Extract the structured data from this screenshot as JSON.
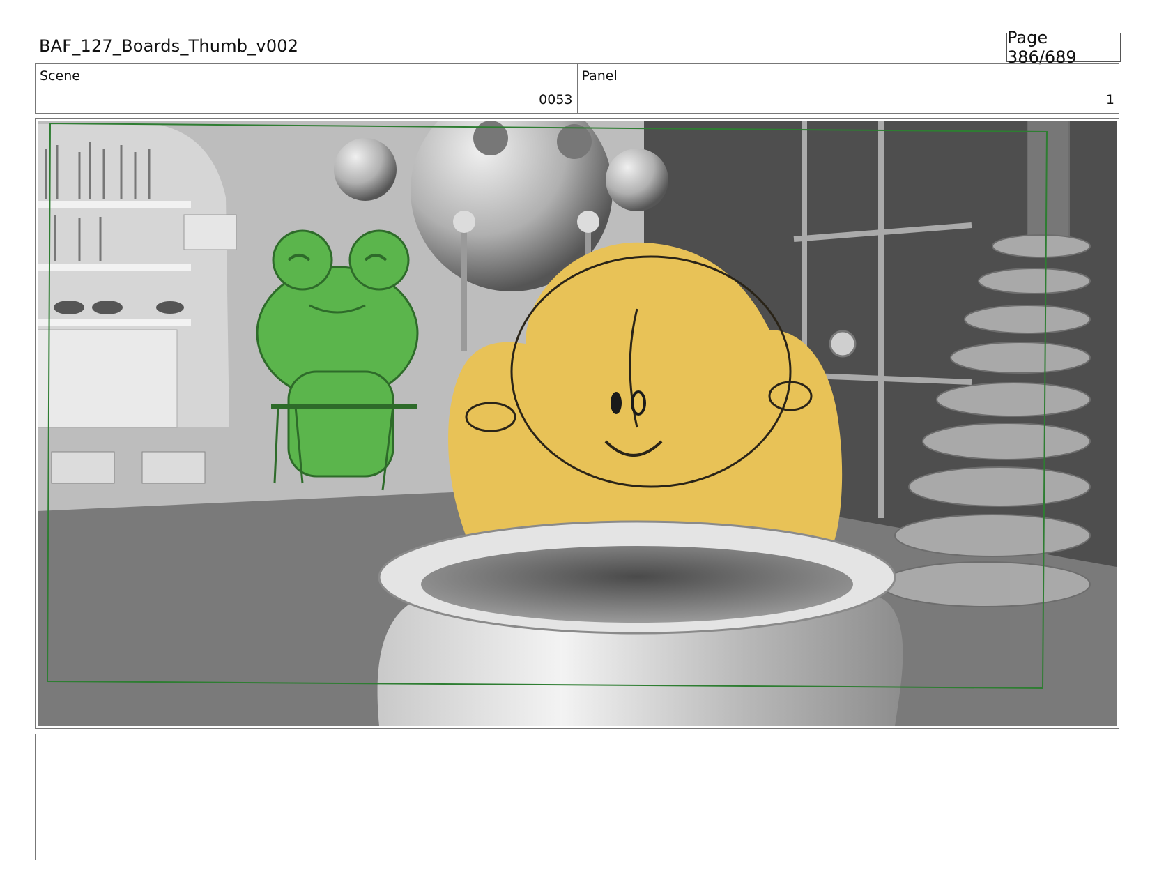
{
  "header": {
    "title": "BAF_127_Boards_Thumb_v002",
    "page": "Page 386/689"
  },
  "info": {
    "scene_label": "Scene",
    "scene_value": "0053",
    "panel_label": "Panel",
    "panel_value": "1"
  },
  "notes": {
    "text": ""
  },
  "colors": {
    "safe_frame": "#2e7d32",
    "frog": "#5bb54c",
    "blob": "#e8c257"
  }
}
